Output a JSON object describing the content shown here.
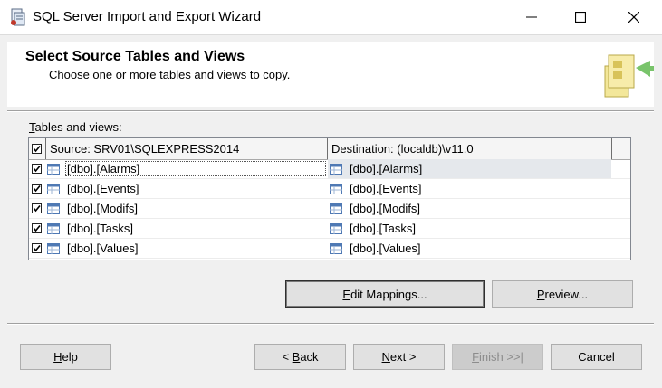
{
  "window": {
    "title": "SQL Server Import and Export Wizard"
  },
  "header": {
    "title": "Select Source Tables and Views",
    "subtitle": "Choose one or more tables and views to copy."
  },
  "tables_label": {
    "prefix": "",
    "mnemonic": "T",
    "rest": "ables and views:"
  },
  "grid": {
    "header_checked": true,
    "source_header": "Source: SRV01\\SQLEXPRESS2014",
    "destination_header": "Destination: (localdb)\\v11.0",
    "rows": [
      {
        "checked": true,
        "source": "[dbo].[Alarms]",
        "destination": "[dbo].[Alarms]"
      },
      {
        "checked": true,
        "source": "[dbo].[Events]",
        "destination": "[dbo].[Events]"
      },
      {
        "checked": true,
        "source": "[dbo].[Modifs]",
        "destination": "[dbo].[Modifs]"
      },
      {
        "checked": true,
        "source": "[dbo].[Tasks]",
        "destination": "[dbo].[Tasks]"
      },
      {
        "checked": true,
        "source": "[dbo].[Values]",
        "destination": "[dbo].[Values]"
      }
    ]
  },
  "buttons": {
    "edit_mappings": {
      "mnemonic": "E",
      "rest": "dit Mappings..."
    },
    "preview": {
      "mnemonic": "P",
      "rest": "review..."
    },
    "help": {
      "mnemonic": "H",
      "rest": "elp"
    },
    "back": {
      "pre": "< ",
      "mnemonic": "B",
      "rest": "ack"
    },
    "next": {
      "mnemonic": "N",
      "rest": "ext >"
    },
    "finish": {
      "mnemonic": "F",
      "rest": "inish >>|"
    },
    "cancel": {
      "label": "Cancel"
    }
  },
  "icons": {
    "app": "wizard-app-icon",
    "minimize": "minimize-icon",
    "maximize": "maximize-icon",
    "close": "close-icon",
    "header_graphic": "wizard-header-graphic",
    "table": "table-icon"
  },
  "colors": {
    "window_bg": "#f0f0f0",
    "header_bg": "#ffffff",
    "selected_row": "#e5e8ec",
    "button_bg": "#e1e1e1"
  }
}
